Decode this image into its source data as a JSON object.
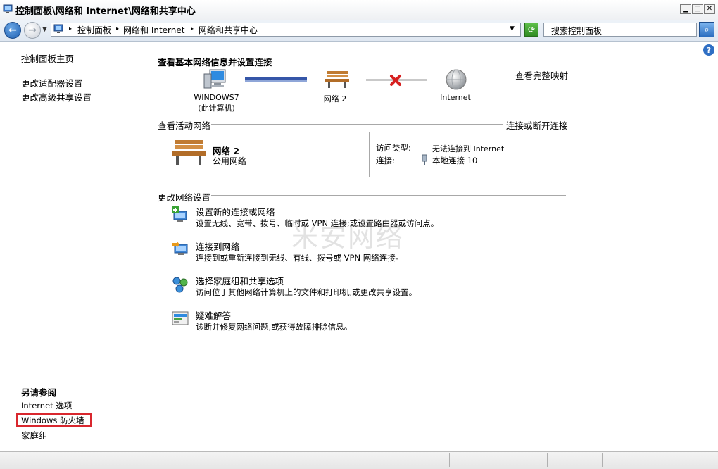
{
  "window": {
    "title": "控制面板\\网络和 Internet\\网络和共享中心",
    "minimize_symbol": "▁",
    "maximize_symbol": "□",
    "close_symbol": "✕"
  },
  "addressbar": {
    "crumbs": [
      "控制面板",
      "网络和 Internet",
      "网络和共享中心"
    ],
    "search_placeholder": "搜索控制面板"
  },
  "left_pane": {
    "links": [
      "控制面板主页",
      "更改适配器设置",
      "更改高级共享设置"
    ],
    "see_also_title": "另请参阅",
    "see_also": [
      "Internet 选项",
      "Windows 防火墙",
      "家庭组"
    ]
  },
  "main": {
    "heading": "查看基本网络信息并设置连接",
    "full_map_link": "查看完整映射",
    "map": {
      "computer_name": "WINDOWS7",
      "computer_sub": "(此计算机)",
      "network": "网络  2",
      "internet": "Internet"
    },
    "active_networks": {
      "section_title": "查看活动网络",
      "connect_link": "连接或断开连接",
      "network_name": "网络  2",
      "network_type": "公用网络",
      "access_type_label": "访问类型:",
      "access_type_value": "无法连接到 Internet",
      "connection_label": "连接:",
      "connection_value": "本地连接 10"
    },
    "change_settings": {
      "section_title": "更改网络设置",
      "tasks": [
        {
          "title": "设置新的连接或网络",
          "desc": "设置无线、宽带、拨号、临时或 VPN 连接;或设置路由器或访问点。",
          "icon": "setup-connection-icon"
        },
        {
          "title": "连接到网络",
          "desc": "连接到或重新连接到无线、有线、拨号或 VPN 网络连接。",
          "icon": "connect-network-icon"
        },
        {
          "title": "选择家庭组和共享选项",
          "desc": "访问位于其他网络计算机上的文件和打印机,或更改共享设置。",
          "icon": "homegroup-icon"
        },
        {
          "title": "疑难解答",
          "desc": "诊断并修复网络问题,或获得故障排除信息。",
          "icon": "troubleshoot-icon"
        }
      ]
    }
  },
  "watermark": "米安网络"
}
